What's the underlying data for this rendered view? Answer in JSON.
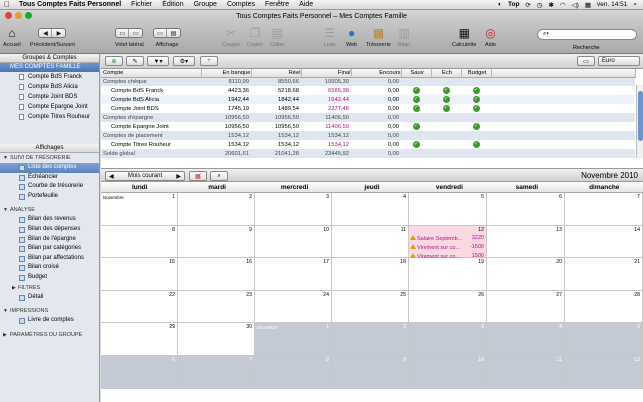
{
  "menubar": {
    "app_name": "Tous Comptes Faits Personnel",
    "items": [
      "Fichier",
      "Édition",
      "Groupe",
      "Comptes",
      "Fenêtre",
      "Aide"
    ],
    "clock": "ven. 14:51",
    "top_label": "Top"
  },
  "window": {
    "title": "Tous Comptes Faits Personnel – Mes Comptes Famille"
  },
  "toolbar": {
    "accueil": "Accueil",
    "precedent": "Précédent/Suivant",
    "volet": "Volet latéral",
    "affichage": "Affichage",
    "couper": "Couper",
    "copier": "Copier",
    "coller": "Coller",
    "liste": "Liste",
    "web": "Web",
    "tresorerie": "Trésorerie",
    "bilan": "Bilan",
    "calculette": "Calculette",
    "aide": "Aide",
    "recherche": "Recherche",
    "search_placeholder": ""
  },
  "sidebar": {
    "header": "Groupes & Comptes",
    "group": "MES COMPTES FAMILLE",
    "accounts": [
      "Compte BdS Franck",
      "Compte BdS Alicia",
      "Compte Joint BDS",
      "Compte Epargne Joint",
      "Compte Titres Rouheur"
    ],
    "affichages": "Affichages",
    "tresorerie_section": "SUIVI DE TRÉSORERIE",
    "tresorerie_items": [
      "Liste des comptes",
      "Echéancier",
      "Courbe de trésorerie",
      "Portefeuille"
    ],
    "analyse_section": "ANALYSE",
    "analyse_items": [
      "Bilan des revenus",
      "Bilan des dépenses",
      "Bilan de l'épargne",
      "Bilan par catégories",
      "Bilan par affectations",
      "Bilan croisé",
      "Budget"
    ],
    "filtres": "FILTRES",
    "filtres_items": [
      "Détail"
    ],
    "impressions": "IMPRESSIONS",
    "impressions_items": [
      "Livre de comptes"
    ],
    "parametres": "PARAMÈTRES DU GROUPE"
  },
  "accounts_table": {
    "currency": "Euro",
    "headers": [
      "Compte",
      "En banque",
      "Réel",
      "Final",
      "Encours",
      "Sauv",
      "Ech",
      "Budget"
    ],
    "rows": [
      {
        "type": "grp",
        "c": [
          "Comptes chèque",
          "8110,99",
          "8550,66",
          "10505,30",
          "0,00"
        ],
        "checks": [
          false,
          false,
          false
        ]
      },
      {
        "type": "acc",
        "c": [
          "Compte BdS Franck",
          "4423,36",
          "5218,68",
          "6585,38",
          "0,00"
        ],
        "checks": [
          true,
          true,
          true
        ],
        "red": true
      },
      {
        "type": "alt",
        "c": [
          "Compte BdS Alicia",
          "1942,44",
          "1842,44",
          "1642,44",
          "0,00"
        ],
        "checks": [
          true,
          true,
          true
        ],
        "red": true
      },
      {
        "type": "acc",
        "c": [
          "Compte Joint BDS",
          "1745,19",
          "1489,54",
          "2277,48",
          "0,00"
        ],
        "checks": [
          true,
          true,
          true
        ],
        "red": true
      },
      {
        "type": "grp",
        "c": [
          "Comptes d'épargne",
          "10956,50",
          "10956,50",
          "11406,50",
          "0,00"
        ],
        "checks": [
          false,
          false,
          false
        ]
      },
      {
        "type": "acc",
        "c": [
          "Compte Epargne Joint",
          "10956,50",
          "10956,50",
          "11406,50",
          "0,00"
        ],
        "checks": [
          true,
          false,
          true
        ],
        "red": true
      },
      {
        "type": "grp",
        "c": [
          "Comptes de placement",
          "1534,12",
          "1534,12",
          "1534,12",
          "0,00"
        ],
        "checks": [
          false,
          false,
          false
        ]
      },
      {
        "type": "acc",
        "c": [
          "Compte Titres Rouheur",
          "1534,12",
          "1534,12",
          "1534,12",
          "0,00"
        ],
        "checks": [
          true,
          false,
          true
        ],
        "red": true
      },
      {
        "type": "grp",
        "c": [
          "Solde global",
          "20601,61",
          "21041,28",
          "23445,92",
          "0,00"
        ],
        "checks": [
          false,
          false,
          false
        ]
      }
    ]
  },
  "calendar": {
    "view_label": "Mois courant",
    "month": "Novembre 2010",
    "days": [
      "lundi",
      "mardi",
      "mercredi",
      "jeudi",
      "vendredi",
      "samedi",
      "dimanche"
    ],
    "month_label": "Novembre",
    "next_month_label": "Décembre",
    "weeks": [
      [
        "1",
        "2",
        "3",
        "4",
        "5",
        "6",
        "7"
      ],
      [
        "8",
        "9",
        "10",
        "11",
        "12",
        "13",
        "14"
      ],
      [
        "15",
        "16",
        "17",
        "18",
        "19",
        "20",
        "21"
      ],
      [
        "22",
        "23",
        "24",
        "25",
        "26",
        "27",
        "28"
      ],
      [
        "29",
        "30",
        "1",
        "2",
        "3",
        "4",
        "5"
      ],
      [
        "6",
        "7",
        "8",
        "9",
        "10",
        "11",
        "12"
      ]
    ],
    "events": [
      {
        "label": "Salaire Septemb...",
        "amount": "3220"
      },
      {
        "label": "Virement sur co...",
        "amount": "-1500"
      },
      {
        "label": "Virement sur co...",
        "amount": "1500"
      }
    ]
  }
}
